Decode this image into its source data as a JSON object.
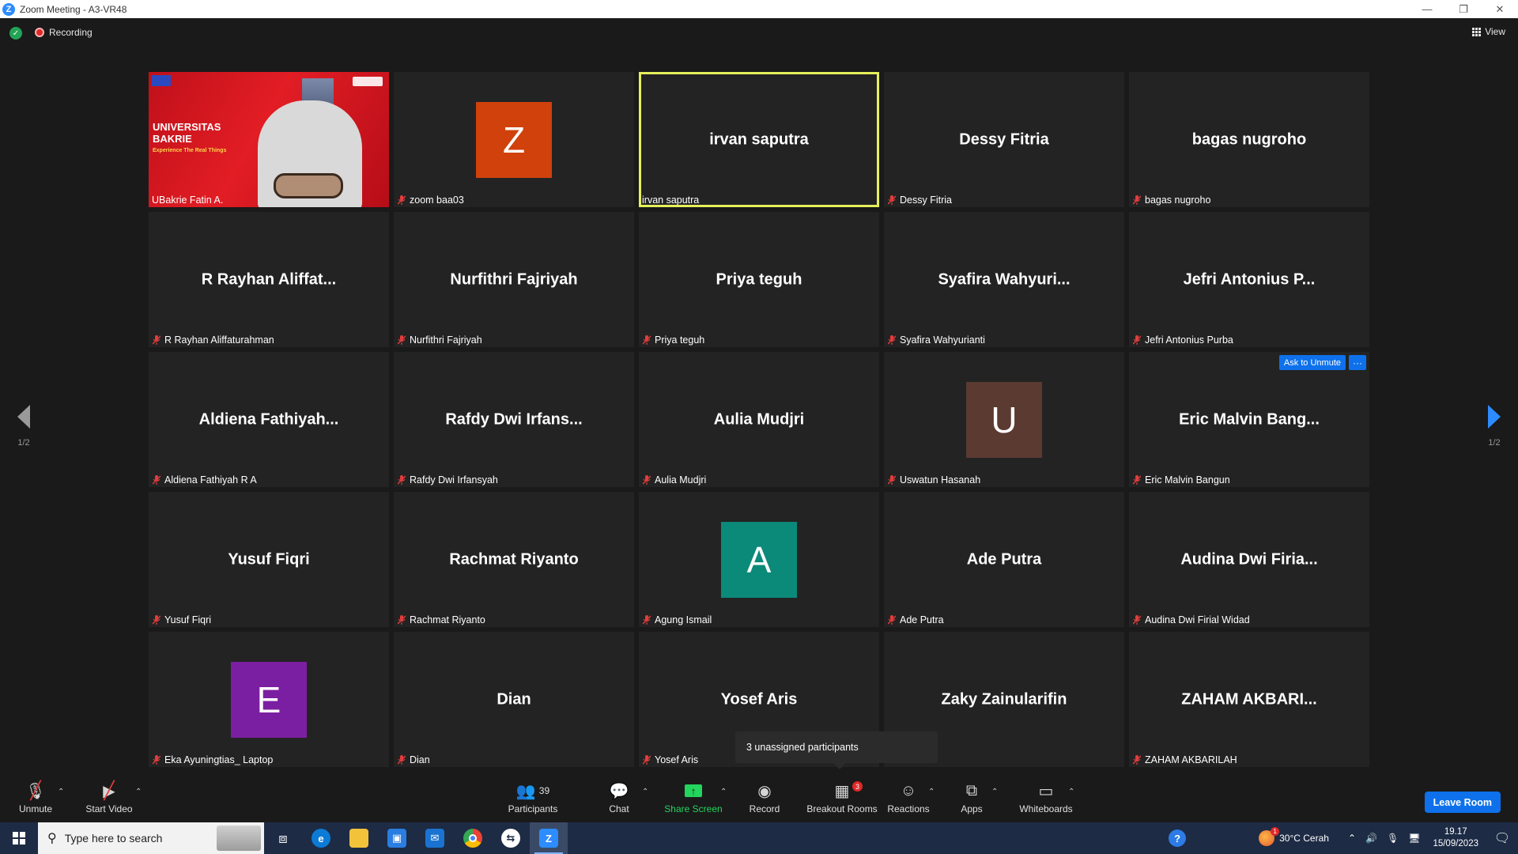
{
  "window": {
    "title": "Zoom Meeting - A3-VR48",
    "logo": "Z",
    "controls": [
      "—",
      "❐",
      "✕"
    ]
  },
  "status": {
    "recording_label": "Recording",
    "view_label": "View"
  },
  "camera": {
    "text_line1": "UNIVERSITAS",
    "text_line2": "BAKRIE",
    "tagline": "Experience The Real Things"
  },
  "tiles": [
    {
      "label": "UBakrie Fatin A.",
      "center": "",
      "avatar": "",
      "avatar_color": "",
      "muted": false,
      "video": true,
      "active": false
    },
    {
      "label": "zoom baa03",
      "center": "",
      "avatar": "Z",
      "avatar_color": "#d1410c",
      "muted": true,
      "video": false,
      "active": false
    },
    {
      "label": "irvan saputra",
      "center": "irvan saputra",
      "avatar": "",
      "avatar_color": "",
      "muted": false,
      "video": false,
      "active": true
    },
    {
      "label": "Dessy Fitria",
      "center": "Dessy Fitria",
      "avatar": "",
      "avatar_color": "",
      "muted": true,
      "video": false,
      "active": false
    },
    {
      "label": "bagas nugroho",
      "center": "bagas nugroho",
      "avatar": "",
      "avatar_color": "",
      "muted": true,
      "video": false,
      "active": false
    },
    {
      "label": "R Rayhan Aliffaturahman",
      "center": "R Rayhan Aliffat...",
      "avatar": "",
      "avatar_color": "",
      "muted": true,
      "video": false,
      "active": false
    },
    {
      "label": "Nurfithri Fajriyah",
      "center": "Nurfithri Fajriyah",
      "avatar": "",
      "avatar_color": "",
      "muted": true,
      "video": false,
      "active": false
    },
    {
      "label": "Priya teguh",
      "center": "Priya teguh",
      "avatar": "",
      "avatar_color": "",
      "muted": true,
      "video": false,
      "active": false
    },
    {
      "label": "Syafira Wahyurianti",
      "center": "Syafira  Wahyuri...",
      "avatar": "",
      "avatar_color": "",
      "muted": true,
      "video": false,
      "active": false
    },
    {
      "label": "Jefri Antonius Purba",
      "center": "Jefri Antonius P...",
      "avatar": "",
      "avatar_color": "",
      "muted": true,
      "video": false,
      "active": false
    },
    {
      "label": "Aldiena Fathiyah R A",
      "center": "Aldiena  Fathiyah...",
      "avatar": "",
      "avatar_color": "",
      "muted": true,
      "video": false,
      "active": false
    },
    {
      "label": "Rafdy Dwi Irfansyah",
      "center": "Rafdy Dwi Irfans...",
      "avatar": "",
      "avatar_color": "",
      "muted": true,
      "video": false,
      "active": false
    },
    {
      "label": "Aulia Mudjri",
      "center": "Aulia Mudjri",
      "avatar": "",
      "avatar_color": "",
      "muted": true,
      "video": false,
      "active": false
    },
    {
      "label": "Uswatun Hasanah",
      "center": "",
      "avatar": "U",
      "avatar_color": "#5b3a32",
      "muted": true,
      "video": false,
      "active": false
    },
    {
      "label": "Eric Malvin Bangun",
      "center": "Eric Malvin Bang...",
      "avatar": "",
      "avatar_color": "",
      "muted": true,
      "video": false,
      "active": false,
      "hover": true
    },
    {
      "label": "Yusuf Fiqri",
      "center": "Yusuf Fiqri",
      "avatar": "",
      "avatar_color": "",
      "muted": true,
      "video": false,
      "active": false
    },
    {
      "label": "Rachmat Riyanto",
      "center": "Rachmat Riyanto",
      "avatar": "",
      "avatar_color": "",
      "muted": true,
      "video": false,
      "active": false
    },
    {
      "label": "Agung Ismail",
      "center": "",
      "avatar": "A",
      "avatar_color": "#0b8a7a",
      "muted": true,
      "video": false,
      "active": false
    },
    {
      "label": "Ade Putra",
      "center": "Ade Putra",
      "avatar": "",
      "avatar_color": "",
      "muted": true,
      "video": false,
      "active": false
    },
    {
      "label": "Audina Dwi Firial Widad",
      "center": "Audina Dwi Firia...",
      "avatar": "",
      "avatar_color": "",
      "muted": true,
      "video": false,
      "active": false
    },
    {
      "label": "Eka Ayuningtias_ Laptop",
      "center": "",
      "avatar": "E",
      "avatar_color": "#7b1fa2",
      "muted": true,
      "video": false,
      "active": false
    },
    {
      "label": "Dian",
      "center": "Dian",
      "avatar": "",
      "avatar_color": "",
      "muted": true,
      "video": false,
      "active": false
    },
    {
      "label": "Yosef Aris",
      "center": "Yosef Aris",
      "avatar": "",
      "avatar_color": "",
      "muted": true,
      "video": false,
      "active": false
    },
    {
      "label": "nularifin",
      "center": "Zaky Zainularifin",
      "avatar": "",
      "avatar_color": "",
      "muted": false,
      "video": false,
      "active": false
    },
    {
      "label": "ZAHAM AKBARILAH",
      "center": "ZAHAM  AKBARI...",
      "avatar": "",
      "avatar_color": "",
      "muted": true,
      "video": false,
      "active": false
    }
  ],
  "hover_actions": {
    "ask_to_unmute": "Ask to Unmute",
    "more": "···"
  },
  "pagination": {
    "left": "1/2",
    "right": "1/2"
  },
  "tooltip": "3 unassigned participants",
  "toolbar": {
    "unmute": "Unmute",
    "start_video": "Start Video",
    "participants": "Participants",
    "participants_count": "39",
    "chat": "Chat",
    "share_screen": "Share Screen",
    "record": "Record",
    "breakout_rooms": "Breakout Rooms",
    "breakout_badge": "3",
    "reactions": "Reactions",
    "apps": "Apps",
    "whiteboards": "Whiteboards",
    "leave": "Leave Room"
  },
  "taskbar": {
    "search_placeholder": "Type here to search",
    "weather": "30°C  Cerah",
    "weather_badge": "1",
    "time": "19.17",
    "date": "15/09/2023"
  }
}
